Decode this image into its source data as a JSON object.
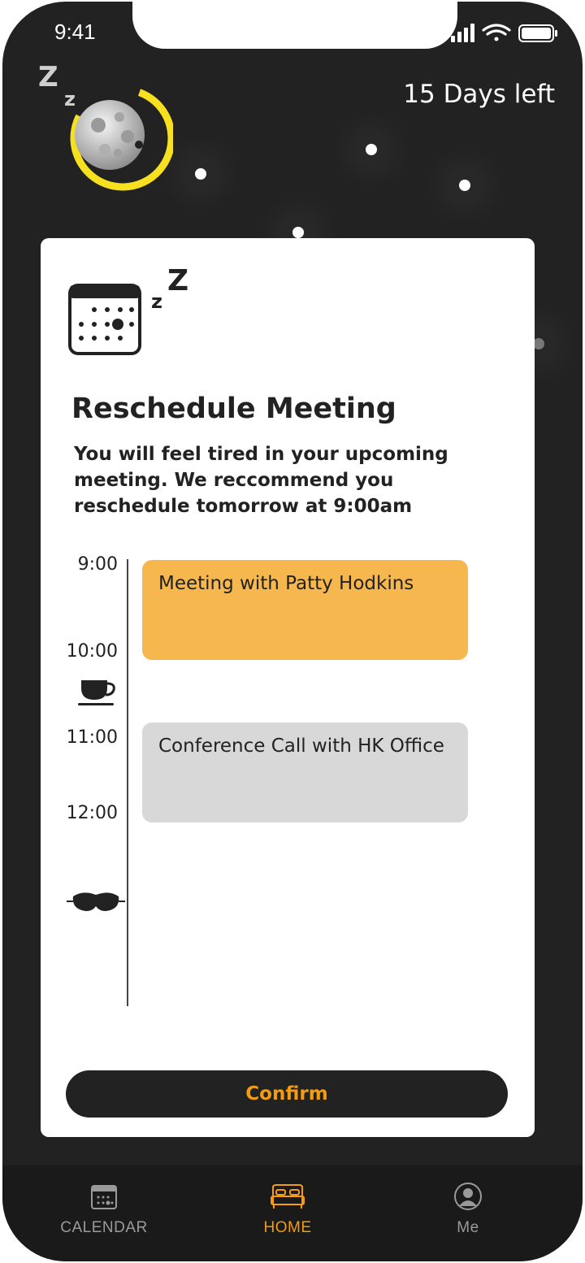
{
  "status_bar": {
    "time": "9:41"
  },
  "header": {
    "days_left": "15 Days left"
  },
  "card": {
    "title": "Reschedule Meeting",
    "body": "You will feel tired in your upcoming meeting. We reccommend you reschedule tomorrow at 9:00am",
    "timeline": {
      "times": [
        "9:00",
        "10:00",
        "11:00",
        "12:00"
      ],
      "events": [
        {
          "title": "Meeting with Patty Hodkins",
          "color": "#F6B84E"
        },
        {
          "title": "Conference Call with HK Office",
          "color": "#D8D8D8"
        }
      ]
    },
    "confirm_label": "Confirm"
  },
  "tabbar": {
    "items": [
      {
        "label": "CALENDAR",
        "icon": "calendar-icon",
        "active": false
      },
      {
        "label": "HOME",
        "icon": "bed-icon",
        "active": true
      },
      {
        "label": "Me",
        "icon": "profile-icon",
        "active": false
      }
    ],
    "active_color": "#F39C12",
    "inactive_color": "#9A9A9A"
  },
  "colors": {
    "background": "#222222",
    "accent_yellow": "#F7E020",
    "meeting_event": "#F6B84E",
    "call_event": "#D8D8D8"
  }
}
